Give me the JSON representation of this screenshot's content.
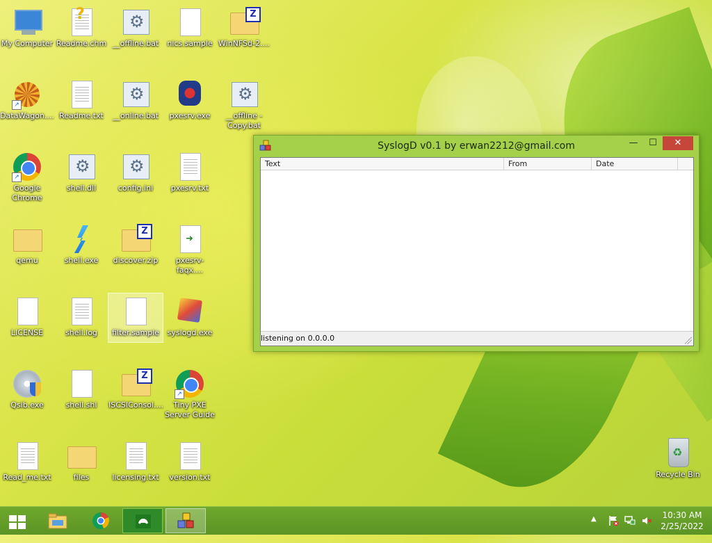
{
  "desktop": {
    "icons": [
      {
        "label": "My Computer"
      },
      {
        "label": "Readme.chm"
      },
      {
        "label": "__offline.bat"
      },
      {
        "label": "nics.sample"
      },
      {
        "label": "WinNFSd-2...."
      },
      {
        "label": "DataWagon...."
      },
      {
        "label": "Readme.txt"
      },
      {
        "label": "__online.bat"
      },
      {
        "label": "pxesrv.exe"
      },
      {
        "label": "__offline - Copy.bat"
      },
      {
        "label": "Google Chrome"
      },
      {
        "label": "shell.dll"
      },
      {
        "label": "config.ini"
      },
      {
        "label": "pxesrv.txt"
      },
      {
        "label": "qemu"
      },
      {
        "label": "shell.exe"
      },
      {
        "label": "discover.zip"
      },
      {
        "label": "pxesrv-faqx...."
      },
      {
        "label": "LICENSE"
      },
      {
        "label": "shell.log"
      },
      {
        "label": "filter.sample"
      },
      {
        "label": "syslogd.exe"
      },
      {
        "label": "Qsib.exe"
      },
      {
        "label": "shell.shl"
      },
      {
        "label": "ISCSIConsol...."
      },
      {
        "label": "Tiny PXE Server Guide"
      },
      {
        "label": "Read_me.txt"
      },
      {
        "label": "files"
      },
      {
        "label": "licensing.txt"
      },
      {
        "label": "version.txt"
      },
      {
        "label": "Recycle Bin"
      }
    ]
  },
  "window": {
    "title": "SyslogD v0.1 by erwan2212@gmail.com",
    "min_glyph": "—",
    "max_glyph": "☐",
    "close_glyph": "✕",
    "columns": [
      "Text",
      "From",
      "Date"
    ],
    "status": "listening on 0.0.0.0"
  },
  "taskbar": {
    "clock_time": "10:30 AM",
    "clock_date": "2/25/2022",
    "tray_up_glyph": "▲"
  },
  "colors": {
    "window_frame": "#a4d04a",
    "taskbar": "#5c9426",
    "close_button": "#c7463a"
  }
}
